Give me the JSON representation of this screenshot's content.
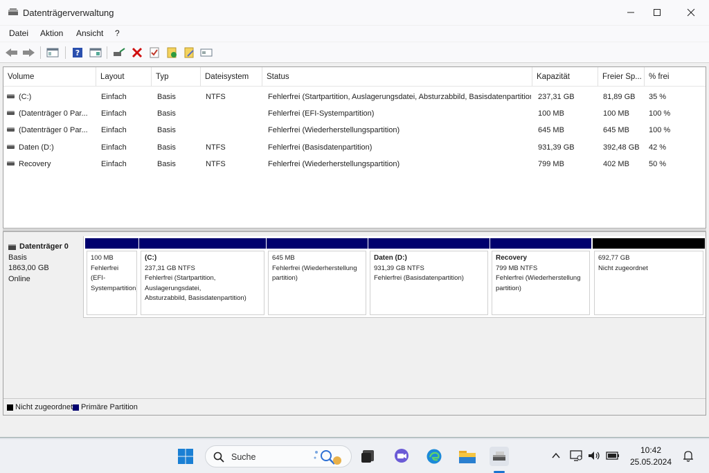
{
  "window": {
    "title": "Datenträgerverwaltung",
    "controls": {
      "minimize": "—",
      "maximize": "☐",
      "close": "✕"
    }
  },
  "menu": [
    "Datei",
    "Aktion",
    "Ansicht",
    "?"
  ],
  "toolbar": {
    "buttons": [
      "back-arrow",
      "forward-arrow",
      "console-tree",
      "help",
      "properties-view",
      "connect-disk",
      "delete",
      "check",
      "new-volume",
      "edit-volume",
      "format"
    ]
  },
  "volume_list": {
    "columns": [
      "Volume",
      "Layout",
      "Typ",
      "Dateisystem",
      "Status",
      "Kapazität",
      "Freier Sp...",
      "% frei"
    ],
    "rows": [
      {
        "volume": "(C:)",
        "layout": "Einfach",
        "type": "Basis",
        "fs": "NTFS",
        "status": "Fehlerfrei (Startpartition, Auslagerungsdatei, Absturzabbild, Basisdatenpartition)",
        "capacity": "237,31 GB",
        "free": "81,89 GB",
        "pct": "35 %"
      },
      {
        "volume": "(Datenträger 0 Par...",
        "layout": "Einfach",
        "type": "Basis",
        "fs": "",
        "status": "Fehlerfrei (EFI-Systempartition)",
        "capacity": "100 MB",
        "free": "100 MB",
        "pct": "100 %"
      },
      {
        "volume": "(Datenträger 0 Par...",
        "layout": "Einfach",
        "type": "Basis",
        "fs": "",
        "status": "Fehlerfrei (Wiederherstellungspartition)",
        "capacity": "645 MB",
        "free": "645 MB",
        "pct": "100 %"
      },
      {
        "volume": "Daten (D:)",
        "layout": "Einfach",
        "type": "Basis",
        "fs": "NTFS",
        "status": "Fehlerfrei (Basisdatenpartition)",
        "capacity": "931,39 GB",
        "free": "392,48 GB",
        "pct": "42 %"
      },
      {
        "volume": "Recovery",
        "layout": "Einfach",
        "type": "Basis",
        "fs": "NTFS",
        "status": "Fehlerfrei (Wiederherstellungspartition)",
        "capacity": "799 MB",
        "free": "402 MB",
        "pct": "50 %"
      }
    ]
  },
  "disk": {
    "name": "Datenträger 0",
    "type": "Basis",
    "size": "1863,00 GB",
    "state": "Online",
    "partitions": [
      {
        "title": "",
        "line1": "100 MB",
        "line2": "Fehlerfrei (EFI-",
        "line3": "Systempartition)",
        "kind": "primary"
      },
      {
        "title": "(C:)",
        "line1": "237,31 GB NTFS",
        "line2": "Fehlerfrei (Startpartition, Auslagerungsdatei,",
        "line3": "Absturzabbild, Basisdatenpartition)",
        "kind": "primary"
      },
      {
        "title": "",
        "line1": "645 MB",
        "line2": "Fehlerfrei (Wiederherstellung",
        "line3": "partition)",
        "kind": "primary"
      },
      {
        "title": "Daten  (D:)",
        "line1": "931,39 GB NTFS",
        "line2": "Fehlerfrei (Basisdatenpartition)",
        "line3": "",
        "kind": "primary"
      },
      {
        "title": "Recovery",
        "line1": "799 MB NTFS",
        "line2": "Fehlerfrei (Wiederherstellung",
        "line3": "partition)",
        "kind": "primary"
      },
      {
        "title": "",
        "line1": "692,77 GB",
        "line2": "Nicht zugeordnet",
        "line3": "",
        "kind": "unallocated"
      }
    ]
  },
  "legend": [
    {
      "label": "Nicht zugeordnet",
      "color": "#000000"
    },
    {
      "label": "Primäre Partition",
      "color": "#00006e"
    }
  ],
  "taskbar": {
    "search_placeholder": "Suche",
    "time": "10:42",
    "date": "25.05.2024",
    "apps": [
      "windows-start-icon",
      "search-icon",
      "task-view-icon",
      "chat-icon",
      "edge-icon",
      "file-explorer-icon",
      "disk-management-icon"
    ],
    "tray": [
      "chevron-up-icon",
      "network-icon",
      "volume-icon",
      "battery-icon",
      "notifications-icon"
    ]
  }
}
